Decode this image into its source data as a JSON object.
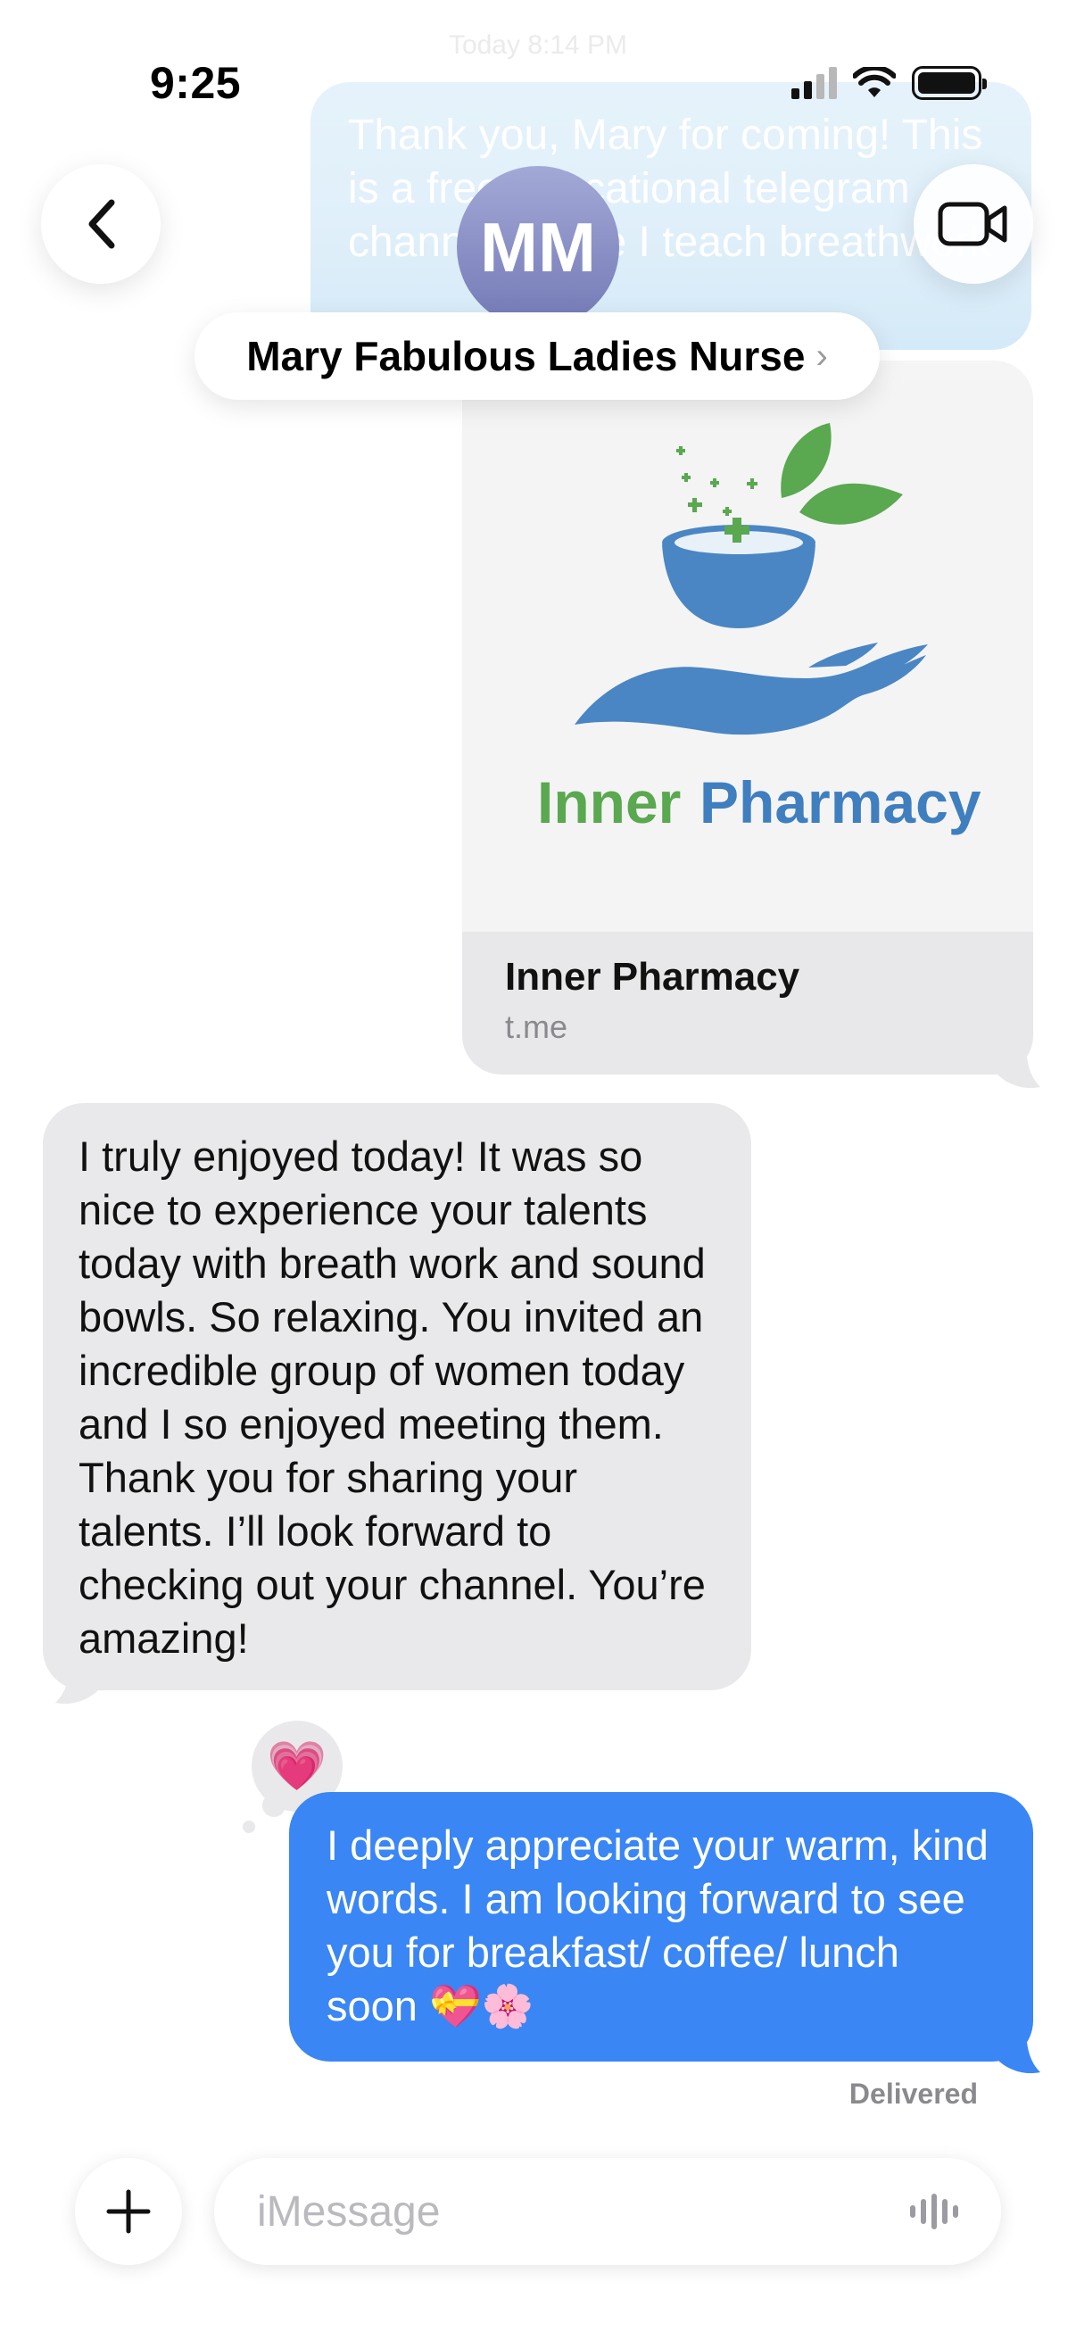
{
  "status_bar": {
    "time": "9:25",
    "icons": [
      "cellular-signal-icon",
      "wifi-icon",
      "battery-icon"
    ]
  },
  "conversation": {
    "timestamp": "Today 8:14 PM",
    "contact_initials": "MM",
    "contact_name": "Mary Fabulous Ladies Nurse",
    "name_chevron": "›"
  },
  "messages": {
    "faded_sent_text": "Thank you, Mary for coming! This is a free educational telegram channel where I teach breathwork",
    "link_preview": {
      "logo_text_1": "Inner",
      "logo_text_2": "Pharmacy",
      "title": "Inner Pharmacy",
      "domain": "t.me"
    },
    "received_text": "I truly enjoyed today! It was so nice to experience your talents today with breath work and sound bowls. So relaxing. You invited an incredible group of women today and I so enjoyed meeting them. Thank you for sharing your talents. I’ll look forward to checking out your channel. You’re amazing!",
    "tapback_emoji": "💗",
    "sent_text": "I deeply appreciate your warm, kind words. I am looking forward to see you for breakfast/ coffee/ lunch soon 💝🌸",
    "delivery_status": "Delivered"
  },
  "composer": {
    "placeholder": "iMessage",
    "value": ""
  },
  "colors": {
    "sent_bubble": "#3a86f4",
    "received_bubble": "#e9e9eb",
    "logo_green": "#5aa84f",
    "logo_blue": "#3f7fbf"
  }
}
